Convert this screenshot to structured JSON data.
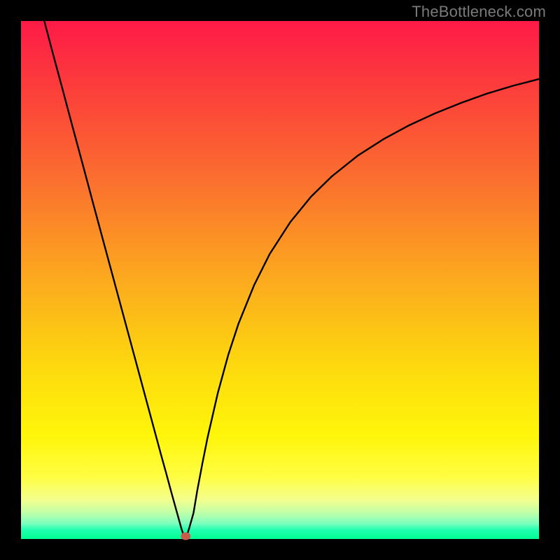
{
  "attribution": "TheBottleneck.com",
  "chart_data": {
    "type": "line",
    "title": "",
    "xlabel": "",
    "ylabel": "",
    "xlim": [
      0,
      100
    ],
    "ylim": [
      0,
      100
    ],
    "x": [
      4.5,
      6,
      8,
      10,
      12,
      14,
      16,
      18,
      20,
      22,
      24,
      26,
      27,
      28,
      29,
      30,
      31,
      31.5,
      31.8,
      32,
      32.5,
      33.3,
      34,
      35,
      36,
      38,
      40,
      42,
      45,
      48,
      52,
      56,
      60,
      65,
      70,
      75,
      80,
      85,
      90,
      95,
      100
    ],
    "values": [
      100,
      94.3,
      86.9,
      79.4,
      72.0,
      64.5,
      57.1,
      49.7,
      42.3,
      34.9,
      27.5,
      20.1,
      16.4,
      12.8,
      9.1,
      5.5,
      1.9,
      0.4,
      0.15,
      0.6,
      2.2,
      5.0,
      9.2,
      14.5,
      19.5,
      28.2,
      35.5,
      41.6,
      49.0,
      55.0,
      61.2,
      66.1,
      70.0,
      74.0,
      77.2,
      79.9,
      82.2,
      84.2,
      86.0,
      87.5,
      88.8
    ],
    "minimum_point": {
      "x": 31.8,
      "y": 0
    },
    "background_gradient": {
      "direction": "vertical",
      "stops": [
        {
          "pos_pct": 0,
          "color": "#fe1a47"
        },
        {
          "pos_pct": 30,
          "color": "#fb6d2f"
        },
        {
          "pos_pct": 50,
          "color": "#fcaa1e"
        },
        {
          "pos_pct": 80,
          "color": "#fff60a"
        },
        {
          "pos_pct": 95,
          "color": "#b9ffab"
        },
        {
          "pos_pct": 100,
          "color": "#00ff91"
        }
      ]
    },
    "note": "Axes have no visible tick labels; x/y are in 0-100 percent of plot area. Curve is a V-shaped bottleneck graph with minimum near x≈32%."
  }
}
